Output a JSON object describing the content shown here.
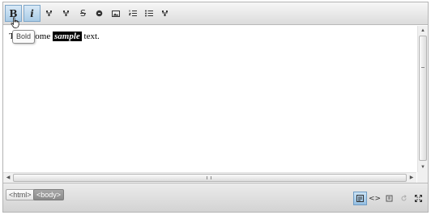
{
  "toolbar": {
    "buttons": [
      {
        "name": "bold-button",
        "label": "B",
        "active": true
      },
      {
        "name": "italic-button",
        "label": "i",
        "active": true
      },
      {
        "name": "plugin-button-1",
        "icon": "plugin-icon"
      },
      {
        "name": "plugin-button-2",
        "icon": "plugin-icon"
      },
      {
        "name": "strikethrough-button",
        "label": "S",
        "icon": "strikethrough-icon"
      },
      {
        "name": "link-button",
        "icon": "link-icon"
      },
      {
        "name": "image-button",
        "icon": "image-icon"
      },
      {
        "name": "ordered-list-button",
        "icon": "ordered-list-icon"
      },
      {
        "name": "unordered-list-button",
        "icon": "unordered-list-icon"
      },
      {
        "name": "plugin-button-3",
        "icon": "plugin-icon"
      }
    ]
  },
  "tooltip": {
    "text": "Bold"
  },
  "content": {
    "before": "T",
    "middle": "some",
    "highlight": "sample",
    "after": "text."
  },
  "statusbar": {
    "breadcrumbs": [
      "<html>",
      "<body>"
    ],
    "buttons": [
      {
        "name": "wysiwyg-mode-button",
        "icon": "wysiwyg-icon",
        "active": true
      },
      {
        "name": "source-mode-button",
        "label": "<>",
        "icon": "code-icon"
      },
      {
        "name": "preview-button",
        "icon": "preview-icon"
      },
      {
        "name": "refresh-button",
        "icon": "refresh-icon",
        "disabled": true
      },
      {
        "name": "fullscreen-button",
        "icon": "fullscreen-icon"
      }
    ]
  },
  "colors": {
    "accent": "#a9cbe6",
    "toolbar_bg": "#e6e6e6",
    "selection": "#000000"
  }
}
